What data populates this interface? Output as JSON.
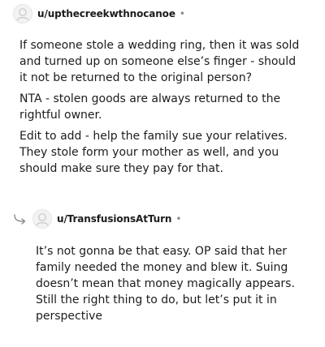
{
  "comments": [
    {
      "username": "u/upthecreekwthnocanoe",
      "separator": "•",
      "avatar_icon": "user-avatar-icon",
      "paragraphs": [
        "If someone stole a wedding ring, then it was sold and turned up on someone else’s finger - should it not be returned to the original person?",
        "NTA - stolen goods are always returned to the rightful owner.",
        "Edit to add - help the family sue your relatives. They stole form your mother as well, and you should make sure they pay for that."
      ]
    },
    {
      "username": "u/TransfusionsAtTurn",
      "separator": "•",
      "avatar_icon": "user-avatar-icon",
      "reply_icon": "reply-arrow-icon",
      "paragraphs": [
        "It’s not gonna be that easy. OP said that her family needed the money and blew it. Suing doesn’t mean that money magically appears. Still the right thing to do, but let’s put it in perspective"
      ]
    }
  ],
  "colors": {
    "text": "#1c1c1c",
    "meta": "#878a8c",
    "avatar_bg": "#f0f0f0"
  }
}
